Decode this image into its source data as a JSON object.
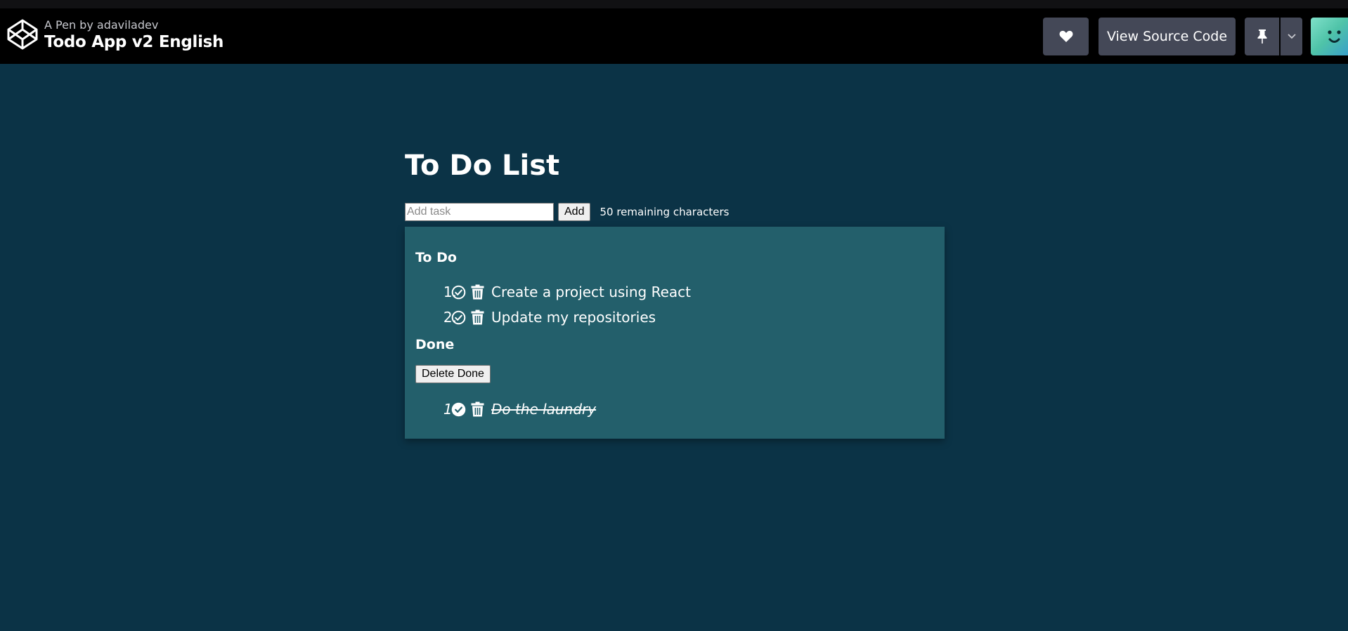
{
  "header": {
    "pen_by": "A Pen by adaviladev",
    "pen_title": "Todo App v2 English",
    "view_source_label": "View Source Code",
    "logo_icon": "codepen-logo-icon",
    "heart_icon": "heart-icon",
    "pin_icon": "pin-icon",
    "caret_icon": "chevron-down-icon"
  },
  "app": {
    "title": "To Do List",
    "input_placeholder": "Add task",
    "input_value": "",
    "add_label": "Add",
    "remaining_text": "50 remaining characters",
    "todo_heading": "To Do",
    "done_heading": "Done",
    "delete_done_label": "Delete Done",
    "todo_items": [
      {
        "num": "1.",
        "text": "Create a project using React"
      },
      {
        "num": "2.",
        "text": "Update my repositories"
      }
    ],
    "done_items": [
      {
        "num": "1.",
        "text": "Do the laundry"
      }
    ]
  },
  "colors": {
    "background": "#0b3346",
    "panel": "#235f6b",
    "header": "#000000",
    "header_button": "#444857"
  }
}
